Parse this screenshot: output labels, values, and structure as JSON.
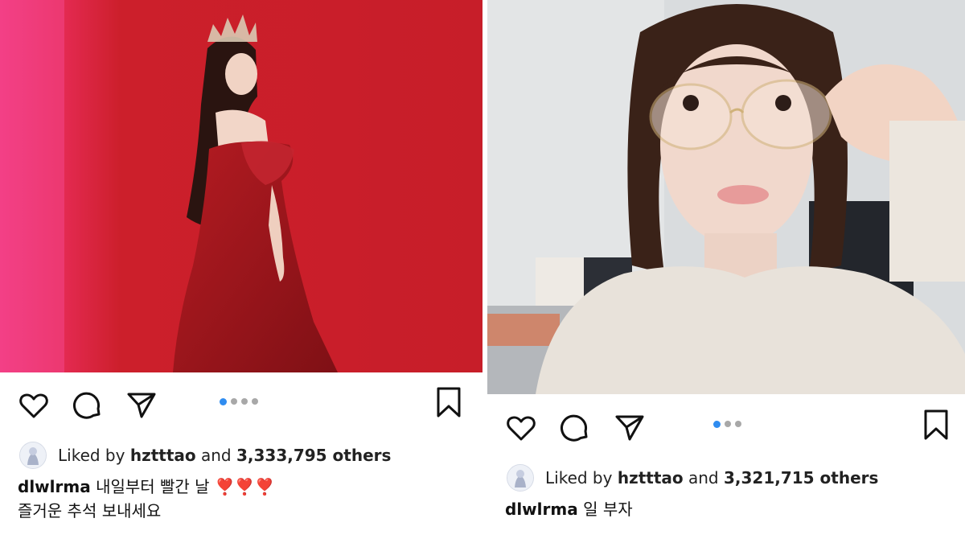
{
  "posts": [
    {
      "liked_by_user": "hztttao",
      "others_count": "3,333,795 others",
      "liked_by_prefix": "Liked by",
      "and_word": "and",
      "caption_user": "dlwlrma",
      "caption_line1": "내일부터 빨간 날",
      "caption_emoji": "❣️❣️❣️",
      "caption_line2": "즐거운 추석 보내세요",
      "carousel_total": 4,
      "carousel_active": 1
    },
    {
      "liked_by_user": "hztttao",
      "others_count": "3,321,715 others",
      "liked_by_prefix": "Liked by",
      "and_word": "and",
      "caption_user": "dlwlrma",
      "caption_line1": "일 부자",
      "carousel_total": 3,
      "carousel_active": 1
    }
  ],
  "colors": {
    "carousel_active": "#2f8cf0",
    "carousel_inactive": "#a8a8a8",
    "left_photo_bg": "#c8202a",
    "left_photo_pink_edge": "#f2357a",
    "dress": "#a3161d"
  },
  "icons": [
    "heart-icon",
    "comment-icon",
    "share-icon",
    "bookmark-icon"
  ]
}
